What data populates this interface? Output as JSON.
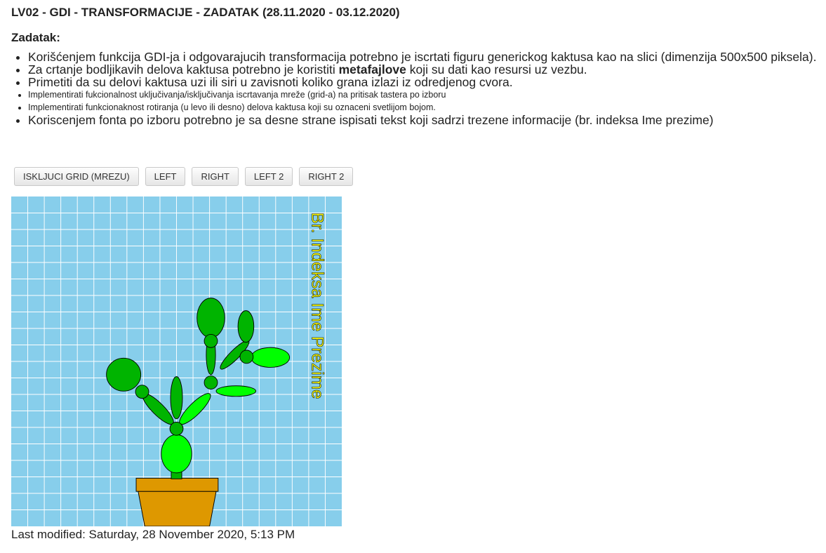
{
  "title": "LV02 - GDI - TRANSFORMACIJE - ZADATAK (28.11.2020 - 03.12.2020)",
  "subtitle": "Zadatak:",
  "tasks": [
    {
      "text": "Korišćenjem funkcija GDI-ja i odgovarajucih transformacija potrebno je iscrtati figuru generickog kaktusa kao na slici (dimenzija 500x500 piksela)."
    },
    {
      "pre": "Za crtanje bodljikavih delova kaktusa potrebno je koristiti ",
      "bold": "metafajlove",
      "post": " koji su dati kao resursi uz vezbu."
    },
    {
      "text": "Primetiti da su delovi kaktusa uzi ili siri u zavisnoti koliko grana izlazi iz odredjenog cvora."
    },
    {
      "text": "Implementirati fukcionalnost uključivanja/isključivanja iscrtavanja mreže (grid-a) na pritisak tastera po izboru"
    },
    {
      "text": "Implementirati funkcionaknost rotiranja (u levo ili desno) delova kaktusa koji su oznaceni svetlijom bojom."
    },
    {
      "text": "Koriscenjem fonta po izboru potrebno je sa desne strane ispisati tekst koji sadrzi trezene informacije (br. indeksa Ime prezime)"
    }
  ],
  "buttons": {
    "grid": "ISKLJUCI GRID (MREZU)",
    "left": "LEFT",
    "right": "RIGHT",
    "left2": "LEFT 2",
    "right2": "RIGHT 2"
  },
  "canvas": {
    "label": "Br. Indeksa Ime Prezime",
    "colors": {
      "background": "#87ceeb",
      "grid": "#ffffff",
      "cactus_dark": "#00b400",
      "cactus_light": "#00ff00",
      "pot": "#de9800",
      "text": "#ffff00"
    }
  },
  "footer": "Last modified: Saturday, 28 November 2020, 5:13 PM"
}
